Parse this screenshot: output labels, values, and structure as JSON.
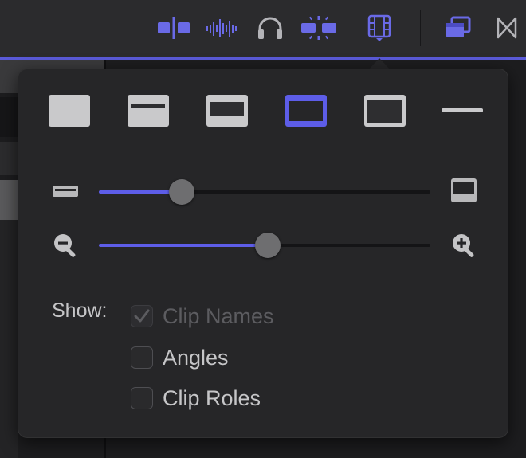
{
  "toolbar": {
    "buttons": [
      {
        "name": "clip-skimming-icon",
        "active": true
      },
      {
        "name": "audio-skimming-icon",
        "active": true
      },
      {
        "name": "solo-headphones-icon",
        "active": false
      },
      {
        "name": "snapping-icon",
        "active": true
      },
      {
        "name": "clip-appearance-icon",
        "active": true
      },
      {
        "name": "browser-toggle-icon",
        "active": true
      },
      {
        "name": "transitions-browser-icon",
        "active": false
      }
    ]
  },
  "popover": {
    "clip_appearance": {
      "options": [
        {
          "name": "waveforms-only",
          "selected": false
        },
        {
          "name": "large-waveforms",
          "selected": false
        },
        {
          "name": "waveforms-and-filmstrips",
          "selected": false
        },
        {
          "name": "large-filmstrips",
          "selected": true
        },
        {
          "name": "filmstrips-only",
          "selected": false
        },
        {
          "name": "clip-labels-only",
          "selected": false
        }
      ]
    },
    "clip_height": {
      "value": 0.25
    },
    "zoom": {
      "value": 0.51
    },
    "show": {
      "label": "Show:",
      "options": [
        {
          "label": "Clip Names",
          "checked": true,
          "enabled": false
        },
        {
          "label": "Angles",
          "checked": false,
          "enabled": true
        },
        {
          "label": "Clip Roles",
          "checked": false,
          "enabled": true
        }
      ]
    }
  },
  "colors": {
    "accent": "#5d5de8",
    "toolbar_icon_active": "#6a6ae6",
    "toolbar_icon_inactive": "#b4b4b8",
    "popover_bg": "#262628"
  }
}
